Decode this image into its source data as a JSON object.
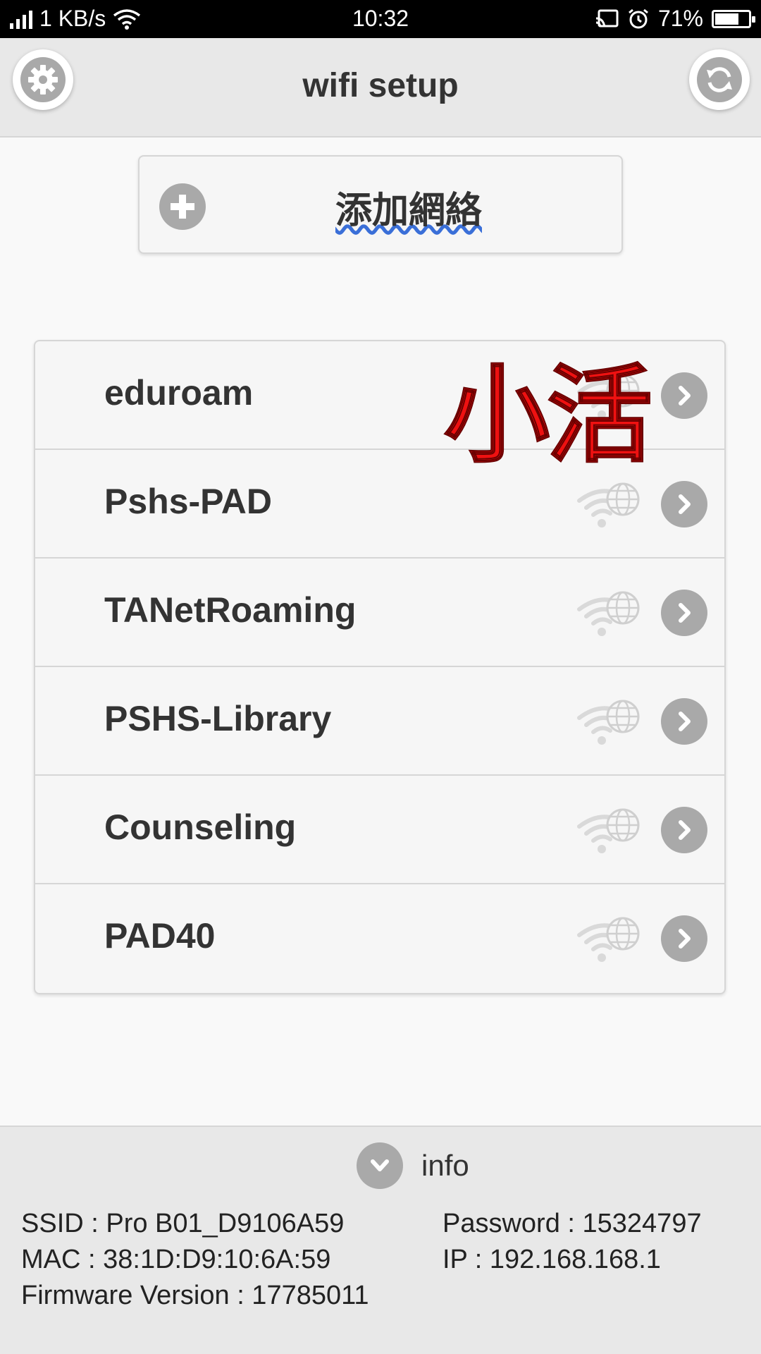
{
  "status_bar": {
    "speed": "1 KB/s",
    "time": "10:32",
    "battery_percent": "71%",
    "battery_level": 0.71,
    "icons": [
      "signal-icon",
      "wifi-icon",
      "cast-icon",
      "alarm-icon",
      "battery-icon"
    ]
  },
  "header": {
    "title": "wifi setup",
    "left_icon": "gear-icon",
    "right_icon": "refresh-icon"
  },
  "add_network": {
    "label": "添加網絡",
    "icon": "plus-icon"
  },
  "networks": [
    {
      "ssid": "eduroam"
    },
    {
      "ssid": "Pshs-PAD"
    },
    {
      "ssid": "TANetRoaming"
    },
    {
      "ssid": "PSHS-Library"
    },
    {
      "ssid": "Counseling"
    },
    {
      "ssid": "PAD40"
    }
  ],
  "overlay_text": "小活",
  "info": {
    "toggle_label": "info",
    "ssid": "SSID : Pro B01_D9106A59",
    "password": "Password : 15324797",
    "mac": "MAC : 38:1D:D9:10:6A:59",
    "ip": "IP : 192.168.168.1",
    "firmware": "Firmware Version : 17785011"
  },
  "colors": {
    "icon_gray": "#a9a9a9",
    "header_bg": "#e8e8e8",
    "overlay_red": "#ee1111"
  }
}
